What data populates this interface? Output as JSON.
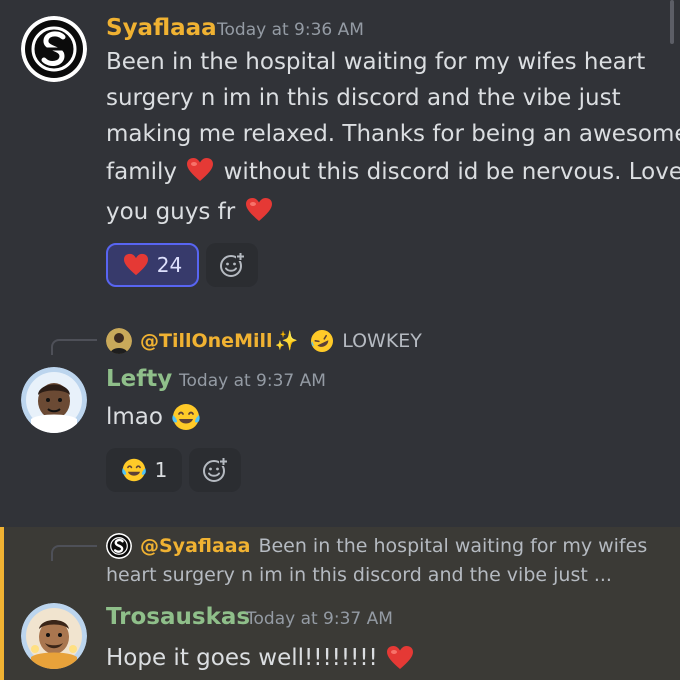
{
  "messages": [
    {
      "author": "Syaflaaa",
      "author_color": "#f0b232",
      "timestamp": "Today at 9:36 AM",
      "lines": [
        "Been in the hospital waiting for my wifes heart",
        "surgery n im in this discord and the vibe just",
        "making me relaxed. Thanks for being an awesome"
      ],
      "line4_a": "family",
      "line4_b": "without this discord id be nervous. Love",
      "line5": "you guys fr",
      "reaction": {
        "emoji": "heart",
        "count": "24"
      }
    },
    {
      "reply": {
        "mention": "@TillOneMill",
        "sparkle": "✨",
        "text": "LOWKEY"
      },
      "author": "Lefty",
      "author_color": "#8fbf8a",
      "timestamp": "Today at 9:37 AM",
      "text": "lmao",
      "reaction": {
        "emoji": "joy",
        "count": "1"
      }
    },
    {
      "reply": {
        "mention": "@Syaflaaa",
        "preview_1": "Been in the hospital waiting for my wifes",
        "preview_2": "heart surgery n im in this discord and the vibe just ..."
      },
      "author": "Trosauskas",
      "author_color": "#8fbf8a",
      "timestamp": "Today at 9:37 AM",
      "text": "Hope it goes well!!!!!!!!"
    }
  ],
  "icons": {
    "heart": "heart-emoji",
    "joy": "joy-emoji",
    "rofl": "rofl-emoji",
    "add_reaction": "add-reaction-icon"
  },
  "colors": {
    "background": "#313338",
    "highlight": "#3b3a36",
    "mention_bar": "#f0b232",
    "active_reaction": "#5865f2"
  }
}
